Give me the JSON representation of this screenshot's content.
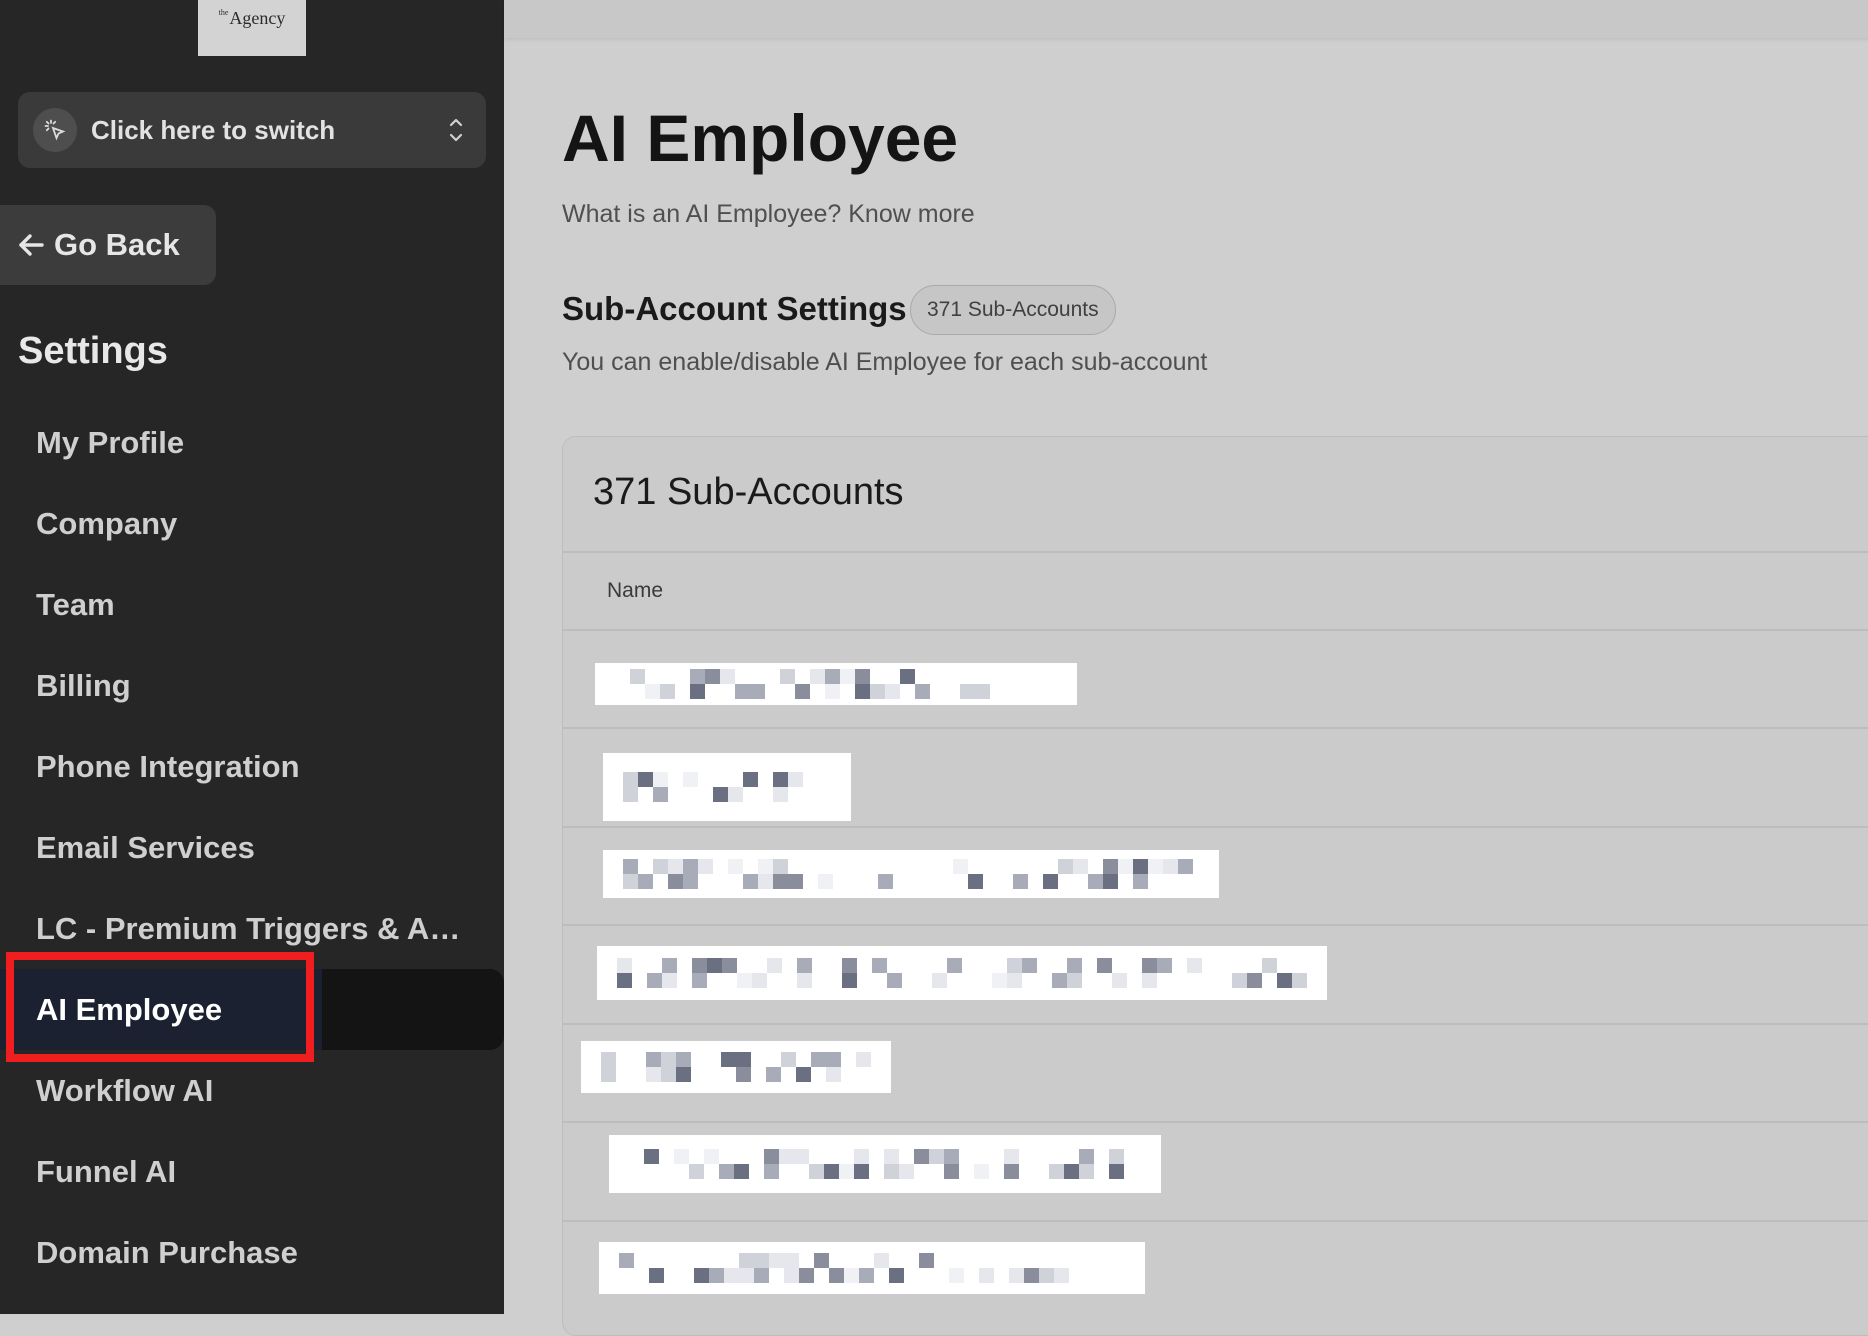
{
  "sidebar": {
    "logo": {
      "small": "the",
      "text": "Agency"
    },
    "switcher": {
      "label": "Click here to switch"
    },
    "go_back": {
      "label": "Go Back"
    },
    "heading": "Settings",
    "items": [
      {
        "label": "My Profile"
      },
      {
        "label": "Company"
      },
      {
        "label": "Team"
      },
      {
        "label": "Billing"
      },
      {
        "label": "Phone Integration"
      },
      {
        "label": "Email Services"
      },
      {
        "label": "LC - Premium Triggers & Actions"
      },
      {
        "label": "AI Employee",
        "active": true
      },
      {
        "label": "Workflow AI"
      },
      {
        "label": "Funnel AI"
      },
      {
        "label": "Domain Purchase"
      }
    ]
  },
  "main": {
    "title": "AI Employee",
    "subtitle": "What is an AI Employee? Know more",
    "section": {
      "title": "Sub-Account Settings",
      "badge": "371 Sub-Accounts",
      "description": "You can enable/disable AI Employee for each sub-account"
    },
    "table": {
      "title": "371 Sub-Accounts",
      "column_header": "Name",
      "rows_note": "Sub-account names are pixelated/redacted in the screenshot"
    }
  },
  "colors": {
    "sidebar_bg": "#262626",
    "main_bg": "#cfcfcf",
    "active_item_bg": "#1b2130",
    "annotation": "#f01e1e"
  }
}
